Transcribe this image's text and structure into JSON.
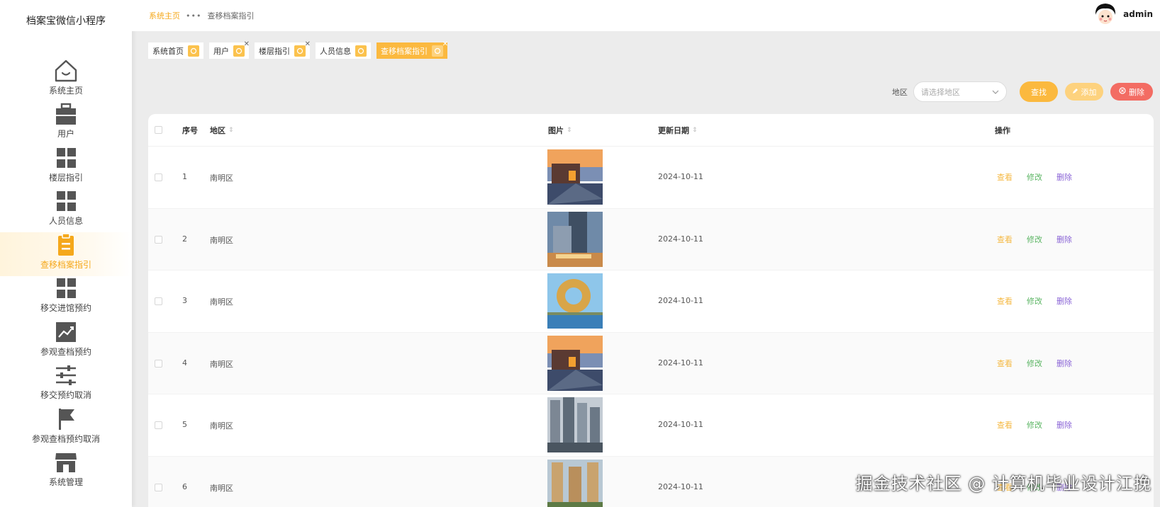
{
  "app": {
    "title": "档案宝微信小程序"
  },
  "sidebar": {
    "items": [
      {
        "label": "系统主页",
        "icon": "home-icon"
      },
      {
        "label": "用户",
        "icon": "briefcase-icon"
      },
      {
        "label": "楼层指引",
        "icon": "grid-icon"
      },
      {
        "label": "人员信息",
        "icon": "grid-icon"
      },
      {
        "label": "查移档案指引",
        "icon": "clipboard-icon",
        "active": true
      },
      {
        "label": "移交进馆预约",
        "icon": "grid-icon"
      },
      {
        "label": "参观查档预约",
        "icon": "chart-icon"
      },
      {
        "label": "移交预约取消",
        "icon": "sliders-icon"
      },
      {
        "label": "参观查档预约取消",
        "icon": "flag-icon"
      },
      {
        "label": "系统管理",
        "icon": "store-icon"
      }
    ]
  },
  "header": {
    "breadcrumb_home": "系统主页",
    "breadcrumb_sep": "•••",
    "breadcrumb_current": "查移档案指引",
    "username": "admin"
  },
  "tags": [
    {
      "label": "系统首页",
      "closable": false
    },
    {
      "label": "用户",
      "closable": true
    },
    {
      "label": "楼层指引",
      "closable": true
    },
    {
      "label": "人员信息",
      "closable": false
    },
    {
      "label": "查移档案指引",
      "closable": true,
      "active": true
    }
  ],
  "toolbar": {
    "filter_label": "地区",
    "region_placeholder": "请选择地区",
    "search_label": "查找",
    "add_label": "添加",
    "delete_label": "删除"
  },
  "table": {
    "columns": {
      "index": "序号",
      "region": "地区",
      "image": "图片",
      "date": "更新日期",
      "actions": "操作"
    },
    "actions": {
      "view": "查看",
      "edit": "修改",
      "delete": "删除"
    },
    "rows": [
      {
        "index": "1",
        "region": "南明区",
        "date": "2024-10-11",
        "image": "building-street"
      },
      {
        "index": "2",
        "region": "南明区",
        "date": "2024-10-11",
        "image": "tower-night"
      },
      {
        "index": "3",
        "region": "南明区",
        "date": "2024-10-11",
        "image": "ring-building"
      },
      {
        "index": "4",
        "region": "南明区",
        "date": "2024-10-11",
        "image": "building-street"
      },
      {
        "index": "5",
        "region": "南明区",
        "date": "2024-10-11",
        "image": "city-highrise"
      },
      {
        "index": "6",
        "region": "南明区",
        "date": "2024-10-11",
        "image": "residential-towers"
      }
    ]
  },
  "watermark": "掘金技术社区 @ 计算机毕业设计江挽",
  "colors": {
    "accent": "#f5a81b",
    "button": "#fbb93f",
    "danger": "#f36c63",
    "edit": "#5bb563",
    "delete": "#8a64d6"
  }
}
